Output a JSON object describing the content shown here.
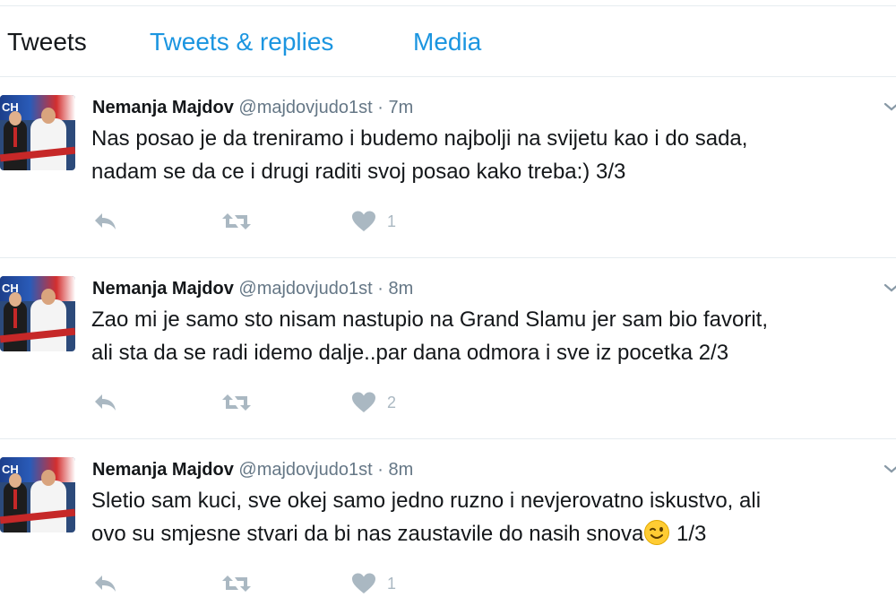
{
  "tabs": [
    {
      "label": "Tweets",
      "active": true
    },
    {
      "label": "Tweets & replies",
      "active": false
    },
    {
      "label": "Media",
      "active": false
    }
  ],
  "colors": {
    "accent": "#1b95e0",
    "muted": "#657786",
    "icon": "#aab8c2",
    "divider": "#e6ecf0"
  },
  "tweets": [
    {
      "name": "Nemanja Majdov",
      "handle": "@majdovjudo1st",
      "separator": "·",
      "time": "7m",
      "line1": "Nas posao je da treniramo i budemo najbolji na svijetu kao i do sada,",
      "line2": "nadam se da ce i drugi raditi svoj posao kako treba:) 3/3",
      "line2_suffix": "",
      "likes": "1",
      "icons": [
        "reply-icon",
        "retweet-icon",
        "heart-icon",
        "chevron-down-icon"
      ]
    },
    {
      "name": "Nemanja Majdov",
      "handle": "@majdovjudo1st",
      "separator": "·",
      "time": "8m",
      "line1": "Zao mi je samo sto nisam nastupio na Grand Slamu jer sam bio favorit,",
      "line2": "ali sta da se radi idemo dalje..par dana odmora i sve iz pocetka 2/3",
      "line2_suffix": "",
      "likes": "2",
      "icons": [
        "reply-icon",
        "retweet-icon",
        "heart-icon",
        "chevron-down-icon"
      ]
    },
    {
      "name": "Nemanja Majdov",
      "handle": "@majdovjudo1st",
      "separator": "·",
      "time": "8m",
      "line1": "Sletio sam kuci, sve okej samo jedno ruzno i nevjerovatno iskustvo, ali",
      "line2": "ovo su smjesne stvari da bi nas zaustavile do nasih snova",
      "line2_suffix": " 1/3",
      "likes": "1",
      "icons": [
        "reply-icon",
        "retweet-icon",
        "heart-icon",
        "chevron-down-icon",
        "winking-face-emoji-icon"
      ]
    }
  ]
}
